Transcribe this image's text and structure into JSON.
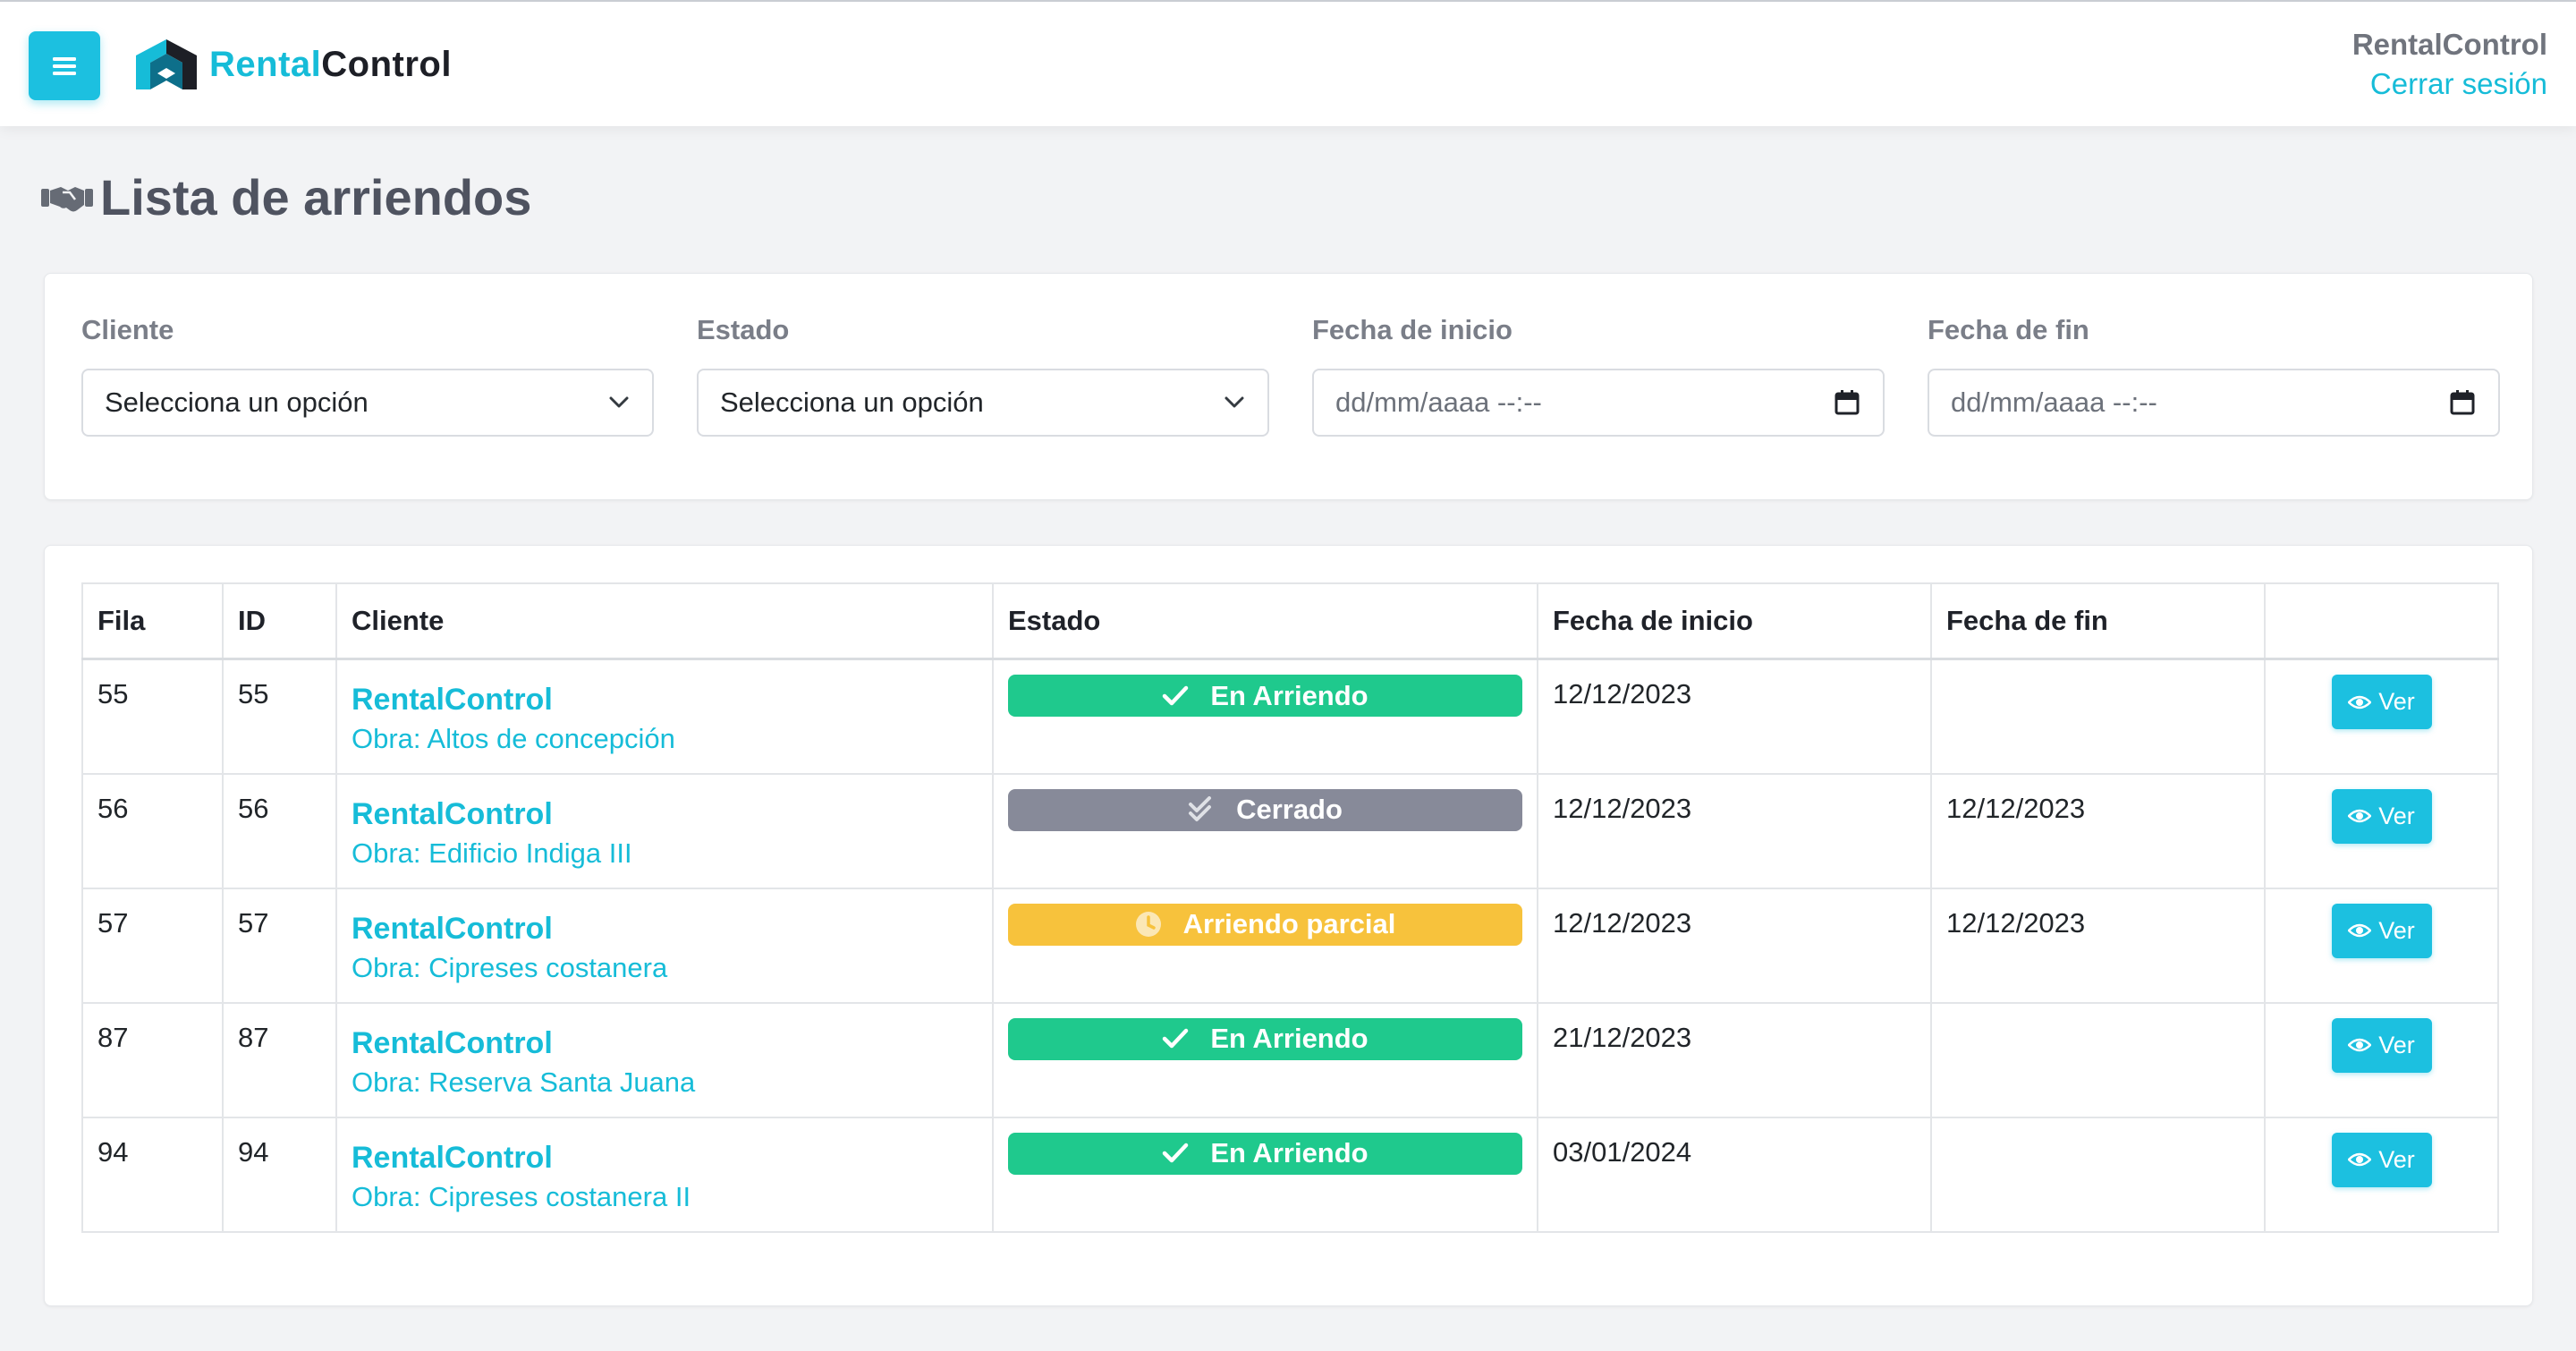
{
  "header": {
    "logo_part1": "Rental",
    "logo_part2": "Control",
    "user_name": "RentalControl",
    "logout_label": "Cerrar sesión"
  },
  "page": {
    "title": "Lista de arriendos",
    "title_icon": "handshake-icon"
  },
  "filters": [
    {
      "label": "Cliente",
      "value": "Selecciona un opción",
      "type": "select"
    },
    {
      "label": "Estado",
      "value": "Selecciona un opción",
      "type": "select"
    },
    {
      "label": "Fecha de inicio",
      "placeholder": "dd/mm/aaaa --:--",
      "type": "datetime"
    },
    {
      "label": "Fecha de fin",
      "placeholder": "dd/mm/aaaa --:--",
      "type": "datetime"
    }
  ],
  "table": {
    "headers": [
      "Fila",
      "ID",
      "Cliente",
      "Estado",
      "Fecha de inicio",
      "Fecha de fin",
      ""
    ],
    "rows": [
      {
        "fila": "55",
        "id": "55",
        "cliente": "RentalControl",
        "obra": "Obra: Altos de concepción",
        "estado": "En Arriendo",
        "estado_kind": "active",
        "inicio": "12/12/2023",
        "fin": "",
        "action": "Ver"
      },
      {
        "fila": "56",
        "id": "56",
        "cliente": "RentalControl",
        "obra": "Obra: Edificio Indiga III",
        "estado": "Cerrado",
        "estado_kind": "closed",
        "inicio": "12/12/2023",
        "fin": "12/12/2023",
        "action": "Ver"
      },
      {
        "fila": "57",
        "id": "57",
        "cliente": "RentalControl",
        "obra": "Obra: Cipreses costanera",
        "estado": "Arriendo parcial",
        "estado_kind": "partial",
        "inicio": "12/12/2023",
        "fin": "12/12/2023",
        "action": "Ver"
      },
      {
        "fila": "87",
        "id": "87",
        "cliente": "RentalControl",
        "obra": "Obra: Reserva Santa Juana",
        "estado": "En Arriendo",
        "estado_kind": "active",
        "inicio": "21/12/2023",
        "fin": "",
        "action": "Ver"
      },
      {
        "fila": "94",
        "id": "94",
        "cliente": "RentalControl",
        "obra": "Obra: Cipreses costanera II",
        "estado": "En Arriendo",
        "estado_kind": "active",
        "inicio": "03/01/2024",
        "fin": "",
        "action": "Ver"
      }
    ]
  },
  "colors": {
    "accent": "#1cc0e0",
    "status_active": "#1fc98d",
    "status_closed": "#878a99",
    "status_partial": "#f7c23c"
  }
}
